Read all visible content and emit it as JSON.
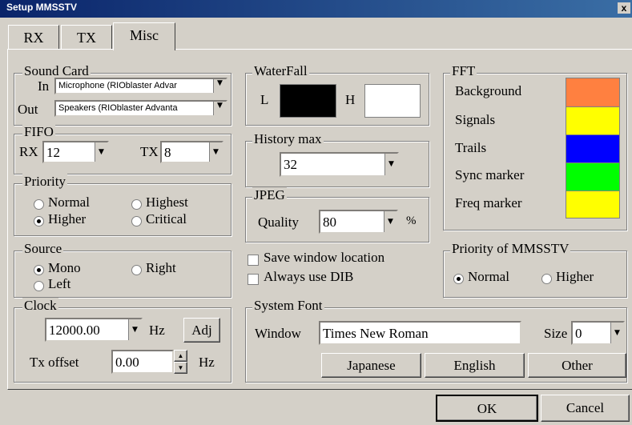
{
  "window": {
    "title": "Setup MMSSTV",
    "close_glyph": "x"
  },
  "tabs": [
    {
      "label": "RX"
    },
    {
      "label": "TX"
    },
    {
      "label": "Misc"
    }
  ],
  "sound_card": {
    "legend": "Sound Card",
    "in_label": "In",
    "in_value": "Microphone (RIOblaster Advar",
    "out_label": "Out",
    "out_value": "Speakers (RIOblaster Advanta"
  },
  "fifo": {
    "legend": "FIFO",
    "rx_label": "RX",
    "rx_value": "12",
    "tx_label": "TX",
    "tx_value": "8"
  },
  "priority": {
    "legend": "Priority",
    "normal": "Normal",
    "highest": "Highest",
    "higher": "Higher",
    "critical": "Critical"
  },
  "source": {
    "legend": "Source",
    "mono": "Mono",
    "right": "Right",
    "left": "Left"
  },
  "clock": {
    "legend": "Clock",
    "value": "12000.00",
    "unit": "Hz",
    "adj_label": "Adj",
    "tx_offset_label": "Tx offset",
    "tx_offset_value": "0.00",
    "tx_offset_unit": "Hz"
  },
  "waterfall": {
    "legend": "WaterFall",
    "l_label": "L",
    "h_label": "H",
    "l_color": "#000000",
    "h_color": "#ffffff"
  },
  "history": {
    "legend": "History max",
    "value": "32"
  },
  "jpeg": {
    "legend": "JPEG",
    "quality_label": "Quality",
    "quality_value": "80",
    "unit": "%"
  },
  "options": {
    "save_window": "Save window location",
    "always_dib": "Always use DIB"
  },
  "fft": {
    "legend": "FFT",
    "items": [
      {
        "label": "Background",
        "color": "#ff8040"
      },
      {
        "label": "Signals",
        "color": "#ffff00"
      },
      {
        "label": "Trails",
        "color": "#0000ff"
      },
      {
        "label": "Sync marker",
        "color": "#00ff00"
      },
      {
        "label": "Freq marker",
        "color": "#ffff00"
      }
    ]
  },
  "priority_mmsstv": {
    "legend": "Priority of MMSSTV",
    "normal": "Normal",
    "higher": "Higher"
  },
  "system_font": {
    "legend": "System Font",
    "window_label": "Window",
    "window_value": "Times New Roman",
    "size_label": "Size",
    "size_value": "0",
    "japanese": "Japanese",
    "english": "English",
    "other": "Other"
  },
  "footer": {
    "ok": "OK",
    "cancel": "Cancel"
  }
}
